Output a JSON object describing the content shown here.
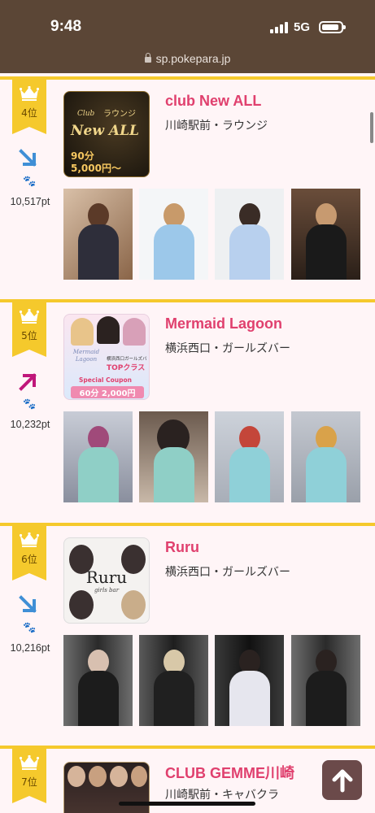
{
  "status_bar": {
    "time": "9:48",
    "network": "5G"
  },
  "browser": {
    "url": "sp.pokepara.jp"
  },
  "rankings": [
    {
      "rank": "4位",
      "trend": "down",
      "paw": "🐾",
      "points": "10,517pt",
      "name": "club New ALL",
      "area": "川崎駅前・ラウンジ",
      "banner": {
        "top": "ラウンジ",
        "club": "Club",
        "main": "New ALL",
        "price1": "90分",
        "price2": "5,000円〜"
      }
    },
    {
      "rank": "5位",
      "trend": "up",
      "paw": "🐾",
      "points": "10,232pt",
      "name": "Mermaid Lagoon",
      "area": "横浜西口・ガールズバー",
      "banner": {
        "logo": "Mermaid Lagoon",
        "tag": "横浜西口ガールズバー",
        "headline": "TOPクラス",
        "coupon": "Special Coupon",
        "price": "60分 2,000円"
      }
    },
    {
      "rank": "6位",
      "trend": "down",
      "paw": "🐾",
      "points": "10,216pt",
      "name": "Ruru",
      "area": "横浜西口・ガールズバー",
      "banner": {
        "logo": "Ruru",
        "sub": "girls bar"
      }
    },
    {
      "rank": "7位",
      "trend": "none",
      "paw": "",
      "points": "",
      "name": "CLUB GEMME川崎",
      "area": "川崎駅前・キャバクラ",
      "banner": {}
    }
  ],
  "colors": {
    "accent": "#e0406e",
    "gold": "#f5c92c",
    "header": "#5b4636",
    "down": "#3f8fd6",
    "up": "#c0177a"
  }
}
